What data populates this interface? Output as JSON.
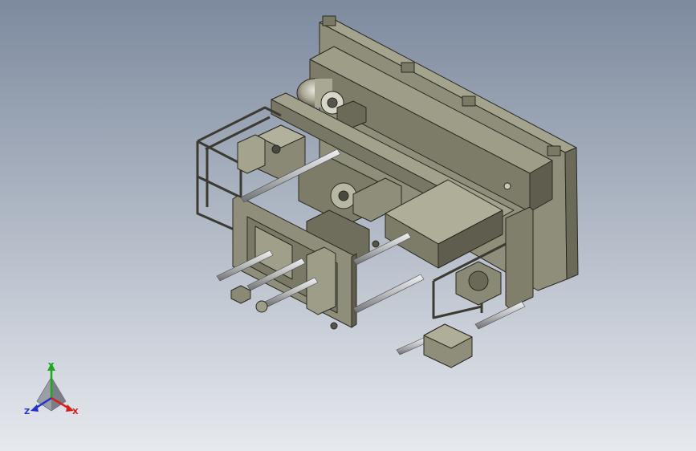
{
  "viewport": {
    "background_top": "#7d8a9e",
    "background_bottom": "#e6e9ee"
  },
  "model": {
    "body_color": "#8f8e7a",
    "shade_color": "#6b6a58",
    "dark_color": "#3c3b32",
    "rod_color": "#c4c6c8"
  },
  "triad": {
    "x_label": "X",
    "y_label": "Y",
    "z_label": "Z",
    "x_color": "#d81e1e",
    "y_color": "#1fa81f",
    "z_color": "#2233cc"
  }
}
